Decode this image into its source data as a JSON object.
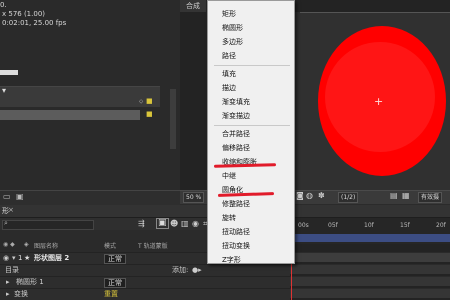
{
  "project": {
    "line1": "0.",
    "line2": "x 576 (1.00)",
    "line3": "0:02:01, 25.00 fps"
  },
  "comp": {
    "tab_label": "合成"
  },
  "viewer_toolbar": {
    "zoom": "50 %",
    "resolution": "(1/2)",
    "view": "有效摄"
  },
  "timeline": {
    "tab_label": "形",
    "col_layer_name": "图层名称",
    "col_mode": "模式",
    "col_trkmat": "T  轨道蒙版",
    "layer_number": "1",
    "layer_name": "形状图层 2",
    "layer_mode": "正常",
    "contents_label": "目录",
    "add_label": "添加:",
    "group_name": "椭圆形 1",
    "group_mode": "正常",
    "transform_label": "变换",
    "reset_label": "重置",
    "ruler_ticks": [
      "00s",
      "05f",
      "10f",
      "15f",
      "20f"
    ]
  },
  "menu": {
    "items": [
      "矩形",
      "椭圆形",
      "多边形",
      "路径",
      "填充",
      "描边",
      "渐变填充",
      "渐变描边",
      "合并路径",
      "偏移路径",
      "收缩和膨胀",
      "中继",
      "圆角化",
      "修整路径",
      "旋转",
      "扭动路径",
      "扭动变换",
      "Z字形"
    ]
  },
  "colors": {
    "shape_fill": "#ff0000",
    "underline": "#e11b2a",
    "work_area": "#3c4d83",
    "mode_text": "#d9c53b"
  }
}
